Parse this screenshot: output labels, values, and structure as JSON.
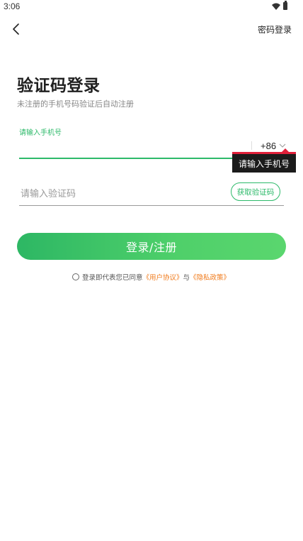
{
  "status_bar": {
    "time": "3:06"
  },
  "header": {
    "back_icon": "chevron-left-icon",
    "password_login_label": "密码登录"
  },
  "page": {
    "title": "验证码登录",
    "subtitle": "未注册的手机号码验证后自动注册"
  },
  "phone": {
    "label": "请输入手机号",
    "value": "",
    "country_code": "+86",
    "tooltip": "请输入手机号"
  },
  "code": {
    "placeholder": "请输入验证码",
    "get_code_label": "获取验证码"
  },
  "submit": {
    "label": "登录/注册"
  },
  "agreement": {
    "prefix": "登录即代表您已同意",
    "user_agreement": "《用户协议》",
    "conjunction": "与",
    "privacy_policy": "《隐私政策》"
  },
  "colors": {
    "accent": "#2dba6a",
    "link": "#f07a1a",
    "tooltip_bg": "#1b1b1b",
    "tooltip_bar": "#e0203a"
  }
}
